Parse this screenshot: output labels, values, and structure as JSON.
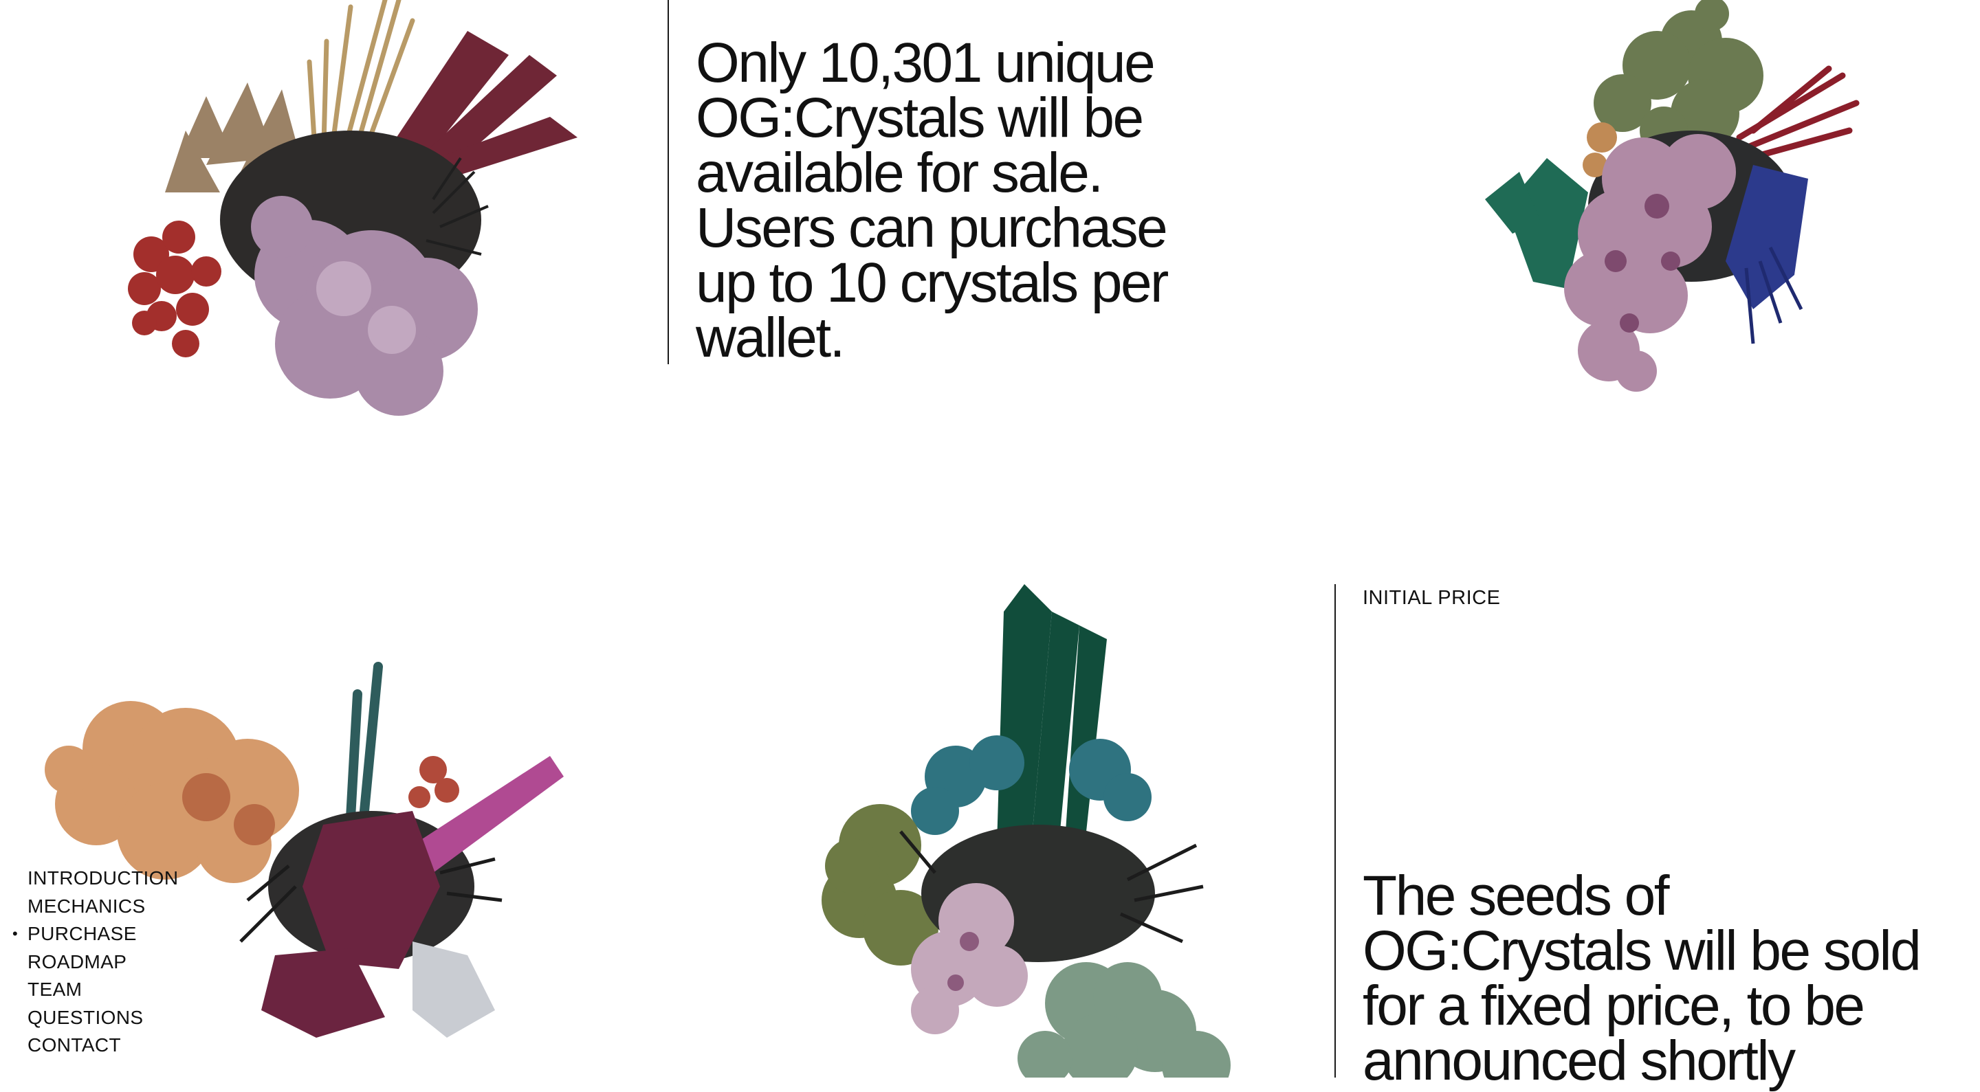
{
  "sections": {
    "availability": {
      "text": "Only 10,301 unique OG:Crystals will be available for sale. Users can purchase up to 10 crystals per wallet."
    },
    "price": {
      "label": "INITIAL PRICE",
      "text": "The seeds of OG:Crystals will be sold for a fixed price, to be announced shortly"
    }
  },
  "nav": {
    "active_marker": "•",
    "items": [
      "INTRODUCTION",
      "MECHANICS",
      "PURCHASE",
      "ROADMAP",
      "TEAM",
      "QUESTIONS",
      "CONTACT"
    ],
    "active_index": 2
  },
  "images": {
    "crystal_1": "crystal-cluster-red-purple",
    "crystal_2": "crystal-cluster-green-pink-blue",
    "crystal_3": "crystal-cluster-orange-magenta",
    "crystal_4": "crystal-cluster-emerald-teal"
  },
  "colors": {
    "background": "#ffffff",
    "text": "#111111",
    "divider": "#1a1a1a"
  }
}
